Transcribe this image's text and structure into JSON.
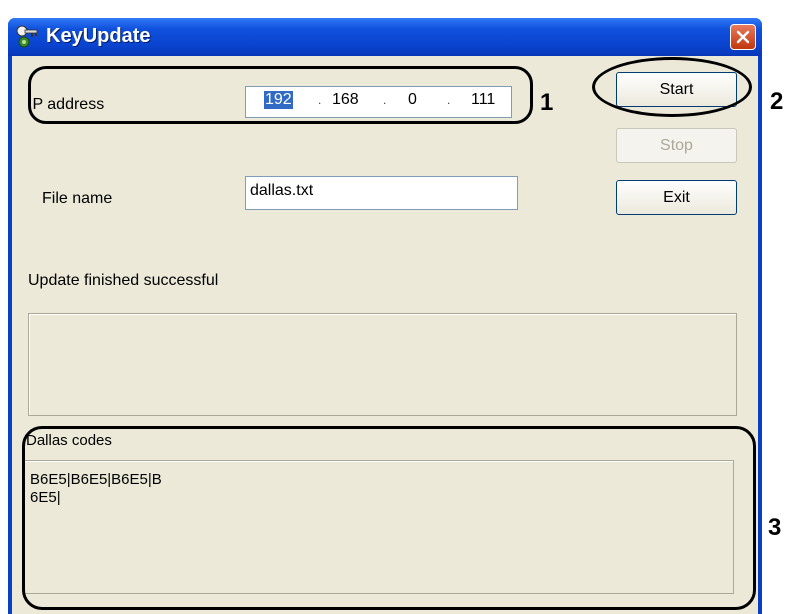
{
  "window": {
    "title": "KeyUpdate",
    "close_glyph": "✕"
  },
  "ip": {
    "label": "IP address",
    "octets": [
      "192",
      "168",
      "0",
      "111"
    ],
    "dot": "."
  },
  "file": {
    "label": "File name",
    "value": "dallas.txt"
  },
  "buttons": {
    "start": "Start",
    "stop": "Stop",
    "exit": "Exit"
  },
  "status": {
    "text": "Update finished successful"
  },
  "dallas": {
    "label": "Dallas codes",
    "line1": "B6E5|B6E5|B6E5|B",
    "line2": "6E5|"
  },
  "annotations": [
    "1",
    "2",
    "3"
  ],
  "colors": {
    "titlebar": "#0a44d0",
    "dialog_bg": "#ece9d8",
    "close": "#c1360e",
    "selection": "#316ac5"
  },
  "icons": [
    "key-update-app-icon",
    "close-icon"
  ]
}
